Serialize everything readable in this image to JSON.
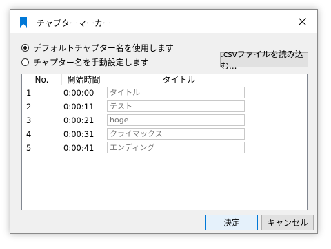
{
  "window": {
    "title": "チャプターマーカー",
    "icon": "bookmark-icon",
    "accent": "#0078d7"
  },
  "options": {
    "default_label": "デフォルトチャプター名を使用します",
    "default_selected": true,
    "manual_label": "チャプター名を手動設定します",
    "manual_selected": false
  },
  "csv_button": ".csvファイルを読み込む...",
  "table": {
    "headers": [
      "No.",
      "開始時間",
      "タイトル"
    ],
    "rows": [
      {
        "no": "1",
        "time": "0:00:00",
        "title": "タイトル"
      },
      {
        "no": "2",
        "time": "0:00:11",
        "title": "テスト"
      },
      {
        "no": "3",
        "time": "0:00:21",
        "title": "hoge"
      },
      {
        "no": "4",
        "time": "0:00:31",
        "title": "クライマックス"
      },
      {
        "no": "5",
        "time": "0:00:41",
        "title": "エンディング"
      }
    ]
  },
  "buttons": {
    "ok": "決定",
    "cancel": "キャンセル"
  }
}
